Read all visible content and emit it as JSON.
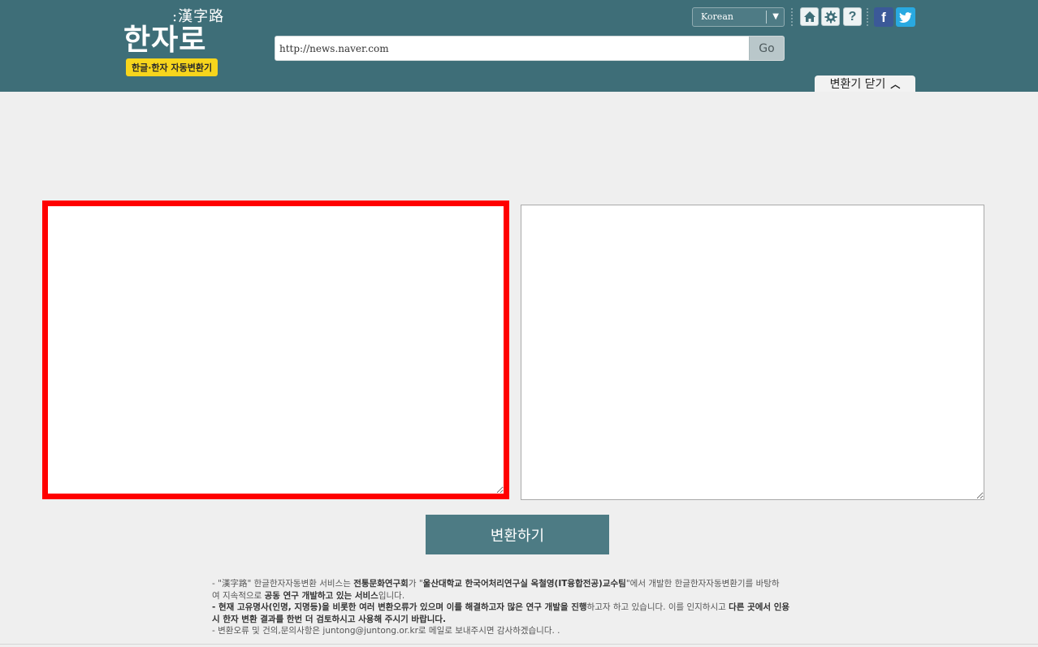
{
  "header": {
    "logo": {
      "hanja": ":漢字路",
      "main": "한자로",
      "tagline": "한글·한자 자동변환기"
    },
    "url_input": {
      "value": "http://news.naver.com",
      "placeholder": ""
    },
    "go_label": "Go",
    "language": {
      "selected": "Korean"
    },
    "icons": [
      "home-icon",
      "gear-icon",
      "help-icon",
      "facebook-icon",
      "twitter-icon"
    ],
    "help_glyph": "?",
    "facebook_glyph": "f",
    "close_converter_label": "변환기 닫기",
    "colors": {
      "header_bg": "#3e6e78",
      "tag_yellow": "#f7d51c",
      "facebook": "#3b5998",
      "twitter": "#29a9e1"
    }
  },
  "main": {
    "input_text": "",
    "output_text": "",
    "convert_label": "변환하기",
    "colors": {
      "highlight_border": "#ff0000",
      "convert_button": "#4d7b84"
    }
  },
  "notes": {
    "line1_a": "- \"漢字路\" 한글한자자동변환 서비스는 ",
    "line1_b": "전통문화연구회",
    "line1_c": "가 \"",
    "line1_d": "울산대학교 한국어처리연구실 옥철영(IT융합전공)교수팀",
    "line1_e": "\"에서 개발한 한글한자자동변환기를 바탕하",
    "line2_a": "여 지속적으로 ",
    "line2_b": "공동 연구 개발하고 있는 서비스",
    "line2_c": "입니다.",
    "line3_a": "- 현재 고유명사(인명, 지명등)을 비롯한 여러 변환오류가 있으며 이를 해결하고자 많은 연구 개발을 진행",
    "line3_b": "하고자 하고 있습니다. 이를 인지하시고 ",
    "line3_c": "다른 곳에서 인용",
    "line4": "시 한자 변환 결과를 한번 더 검토하시고 사용해 주시기 바랍니다.",
    "line5": "- 변환오류 및 건의,문의사항은 juntong@juntong.or.kr로 메일로 보내주시면 감사하겠습니다. ."
  }
}
